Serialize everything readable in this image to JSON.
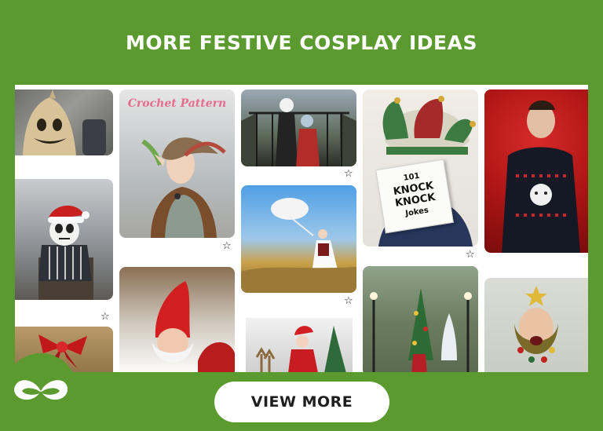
{
  "header": {
    "title": "MORE FESTIVE COSPLAY IDEAS"
  },
  "pins": {
    "crochet_pattern_text": "Crochet Pattern",
    "book_lines": [
      "101",
      "KNOCK",
      "KNOCK",
      "Jokes"
    ]
  },
  "icons": {
    "save": "star-outline-icon",
    "logo": "sprout-logo"
  },
  "cta": {
    "label": "VIEW MORE"
  },
  "colors": {
    "background": "#5a9a2e",
    "board": "#ffffff",
    "button": "#ffffff",
    "button_text": "#1e1e1e"
  }
}
